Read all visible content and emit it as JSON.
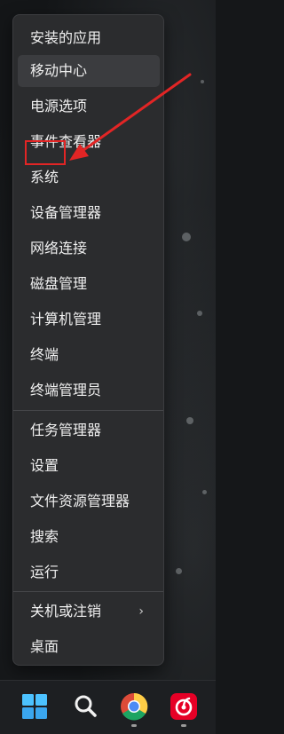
{
  "context_menu": {
    "items": [
      {
        "label": "安装的应用"
      },
      {
        "label": "移动中心"
      },
      {
        "label": "电源选项"
      },
      {
        "label": "事件查看器"
      },
      {
        "label": "系统"
      },
      {
        "label": "设备管理器"
      },
      {
        "label": "网络连接"
      },
      {
        "label": "磁盘管理"
      },
      {
        "label": "计算机管理"
      },
      {
        "label": "终端"
      },
      {
        "label": "终端管理员"
      },
      {
        "label": "任务管理器"
      },
      {
        "label": "设置"
      },
      {
        "label": "文件资源管理器"
      },
      {
        "label": "搜索"
      },
      {
        "label": "运行"
      },
      {
        "label": "关机或注销"
      },
      {
        "label": "桌面"
      }
    ],
    "hovered_item": "移动中心",
    "highlighted_item": "系统",
    "submenu_indicator": "›"
  },
  "annotation": {
    "color": "#e22525"
  },
  "taskbar": {
    "icons": [
      {
        "name": "windows-start-icon"
      },
      {
        "name": "search-icon"
      },
      {
        "name": "chrome-icon"
      },
      {
        "name": "netease-music-icon"
      }
    ]
  }
}
